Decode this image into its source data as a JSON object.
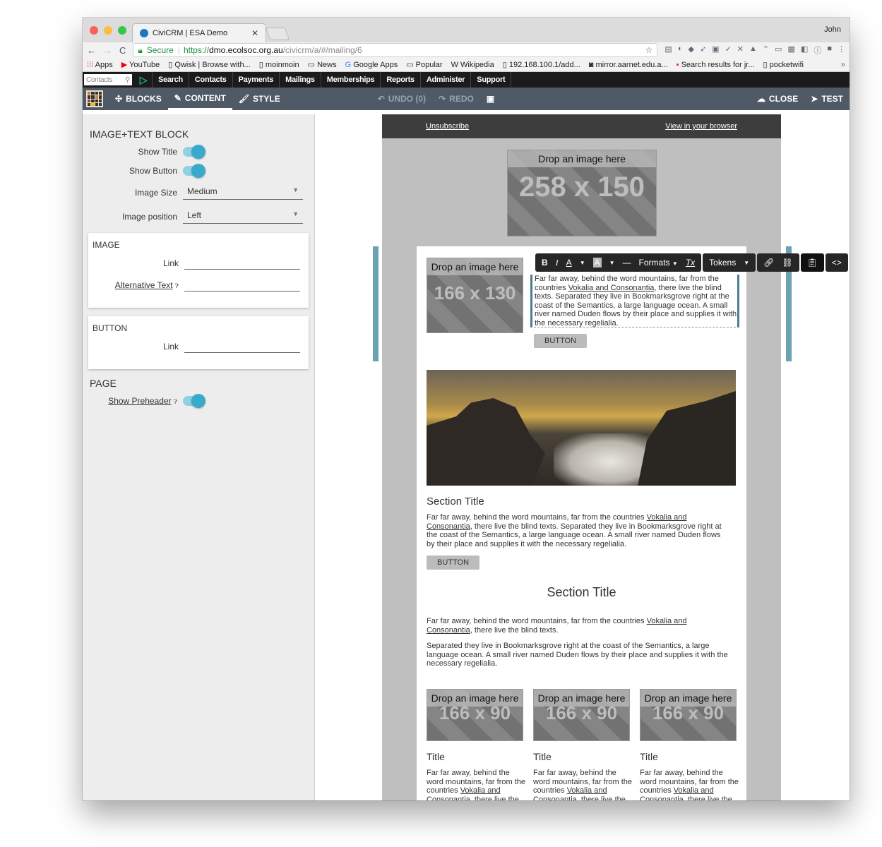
{
  "browser": {
    "tab_title": "CiviCRM | ESA Demo",
    "user": "John",
    "url": {
      "secure_label": "Secure",
      "scheme": "https://",
      "host": "dmo.ecolsoc.org.au",
      "path": "/civicrm/a/#/mailing/6"
    },
    "bookmarks": [
      "Apps",
      "YouTube",
      "Qwisk | Browse with...",
      "moinmoin",
      "News",
      "Google Apps",
      "Popular",
      "Wikipedia",
      "192.168.100.1/add...",
      "mirror.aarnet.edu.a...",
      "Search results for jr...",
      "pocketwifi"
    ],
    "more": "»"
  },
  "civi_menu": {
    "quicksearch_placeholder": "Contacts",
    "items": [
      "Search",
      "Contacts",
      "Payments",
      "Mailings",
      "Memberships",
      "Reports",
      "Administer",
      "Support"
    ]
  },
  "mosaico_toolbar": {
    "blocks": "BLOCKS",
    "content": "CONTENT",
    "style": "STYLE",
    "undo": "UNDO (0)",
    "redo": "REDO",
    "close": "CLOSE",
    "test": "TEST"
  },
  "sidebar": {
    "block_title": "IMAGE+TEXT BLOCK",
    "show_title_label": "Show Title",
    "show_title": true,
    "show_button_label": "Show Button",
    "show_button": true,
    "image_size_label": "Image Size",
    "image_size": "Medium",
    "image_position_label": "Image position",
    "image_position": "Left",
    "image_section": {
      "title": "IMAGE",
      "link_label": "Link",
      "link": "",
      "alt_label": "Alternative Text",
      "alt": ""
    },
    "button_section": {
      "title": "BUTTON",
      "link_label": "Link",
      "link": ""
    },
    "page_section": {
      "title": "PAGE",
      "show_preheader_label": "Show Preheader",
      "show_preheader": true
    }
  },
  "email": {
    "preheader": {
      "unsubscribe": "Unsubscribe",
      "view_browser": "View in your browser"
    },
    "logo_placeholder": {
      "caption": "Drop an image here",
      "size": "258 x 150"
    },
    "image_text_block": {
      "caption": "Drop an image here",
      "size": "166 x 130",
      "text_before": "Far far away, behind the word mountains, far from the countries ",
      "link": "Vokalia and Consonantia",
      "text_after": ", there live the blind texts. Separated they live in Bookmarksgrove right at the coast of the Semantics, a large language ocean. A small river named Duden flows by their place and supplies it with the necessary regelialia.",
      "button": "BUTTON"
    },
    "rte_toolbar": {
      "bold": "B",
      "italic": "I",
      "font_color": "A",
      "bg_color": "A",
      "hr": "—",
      "formats": "Formats",
      "clear": "Tx",
      "tokens": "Tokens"
    },
    "section1": {
      "title": "Section Title",
      "text_before": "Far far away, behind the word mountains, far from the countries ",
      "link": "Vokalia and Consonantia",
      "text_after": ", there live the blind texts. Separated they live in Bookmarksgrove right at the coast of the Semantics, a large language ocean. A small river named Duden flows by their place and supplies it with the necessary regelialia.",
      "button": "BUTTON"
    },
    "section2": {
      "title": "Section Title",
      "p1_before": "Far far away, behind the word mountains, far from the countries ",
      "p1_link": "Vokalia and Consonantia",
      "p1_after": ", there live the blind texts.",
      "p2": "Separated they live in Bookmarksgrove right at the coast of the Semantics, a large language ocean. A small river named Duden flows by their place and supplies it with the necessary regelialia."
    },
    "columns": [
      {
        "caption": "Drop an image here",
        "size": "166 x 90",
        "title": "Title",
        "text_before": "Far far away, behind the word mountains, far from the countries ",
        "link": "Vokalia and Consonantia",
        "text_after": ", there live the"
      },
      {
        "caption": "Drop an image here",
        "size": "166 x 90",
        "title": "Title",
        "text_before": "Far far away, behind the word mountains, far from the countries ",
        "link": "Vokalia and Consonantia",
        "text_after": ", there live the"
      },
      {
        "caption": "Drop an image here",
        "size": "166 x 90",
        "title": "Title",
        "text_before": "Far far away, behind the word mountains, far from the countries ",
        "link": "Vokalia and Consonantia",
        "text_after": ", there live the"
      }
    ]
  }
}
